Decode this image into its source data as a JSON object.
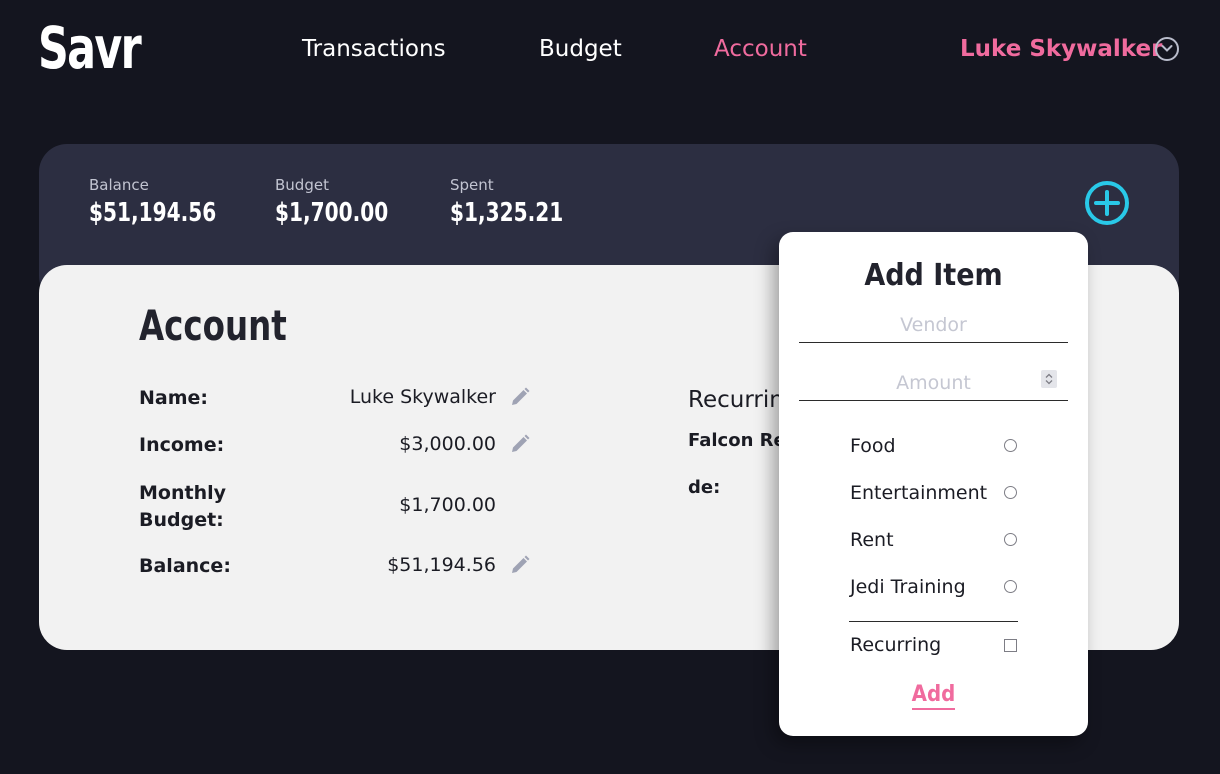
{
  "header": {
    "logo": "Savr",
    "nav": [
      {
        "label": "Transactions"
      },
      {
        "label": "Budget"
      },
      {
        "label": "Account"
      }
    ],
    "user_name": "Luke Skywalker"
  },
  "stats": {
    "balance_label": "Balance",
    "balance_value": "$51,194.56",
    "budget_label": "Budget",
    "budget_value": "$1,700.00",
    "spent_label": "Spent",
    "spent_value": "$1,325.21"
  },
  "account": {
    "title": "Account",
    "rows": [
      {
        "label": "Name:",
        "value": "Luke Skywalker"
      },
      {
        "label": "Income:",
        "value": "$3,000.00"
      },
      {
        "label": "Monthly Budget:",
        "value": "$1,700.00"
      },
      {
        "label": "Balance:",
        "value": "$51,194.56"
      }
    ],
    "recurring_heading": "Recurrin",
    "recurring_items": [
      "Falcon Re",
      "de:"
    ]
  },
  "add_item": {
    "title": "Add Item",
    "vendor_placeholder": "Vendor",
    "amount_placeholder": "Amount",
    "categories": [
      "Food",
      "Entertainment",
      "Rent",
      "Jedi Training"
    ],
    "recurring_label": "Recurring",
    "add_label": "Add"
  },
  "colors": {
    "background": "#14151f",
    "accent": "#f06b9e",
    "add_icon": "#29c9e8",
    "panel": "#2c2e41",
    "card": "#f2f2f2"
  }
}
